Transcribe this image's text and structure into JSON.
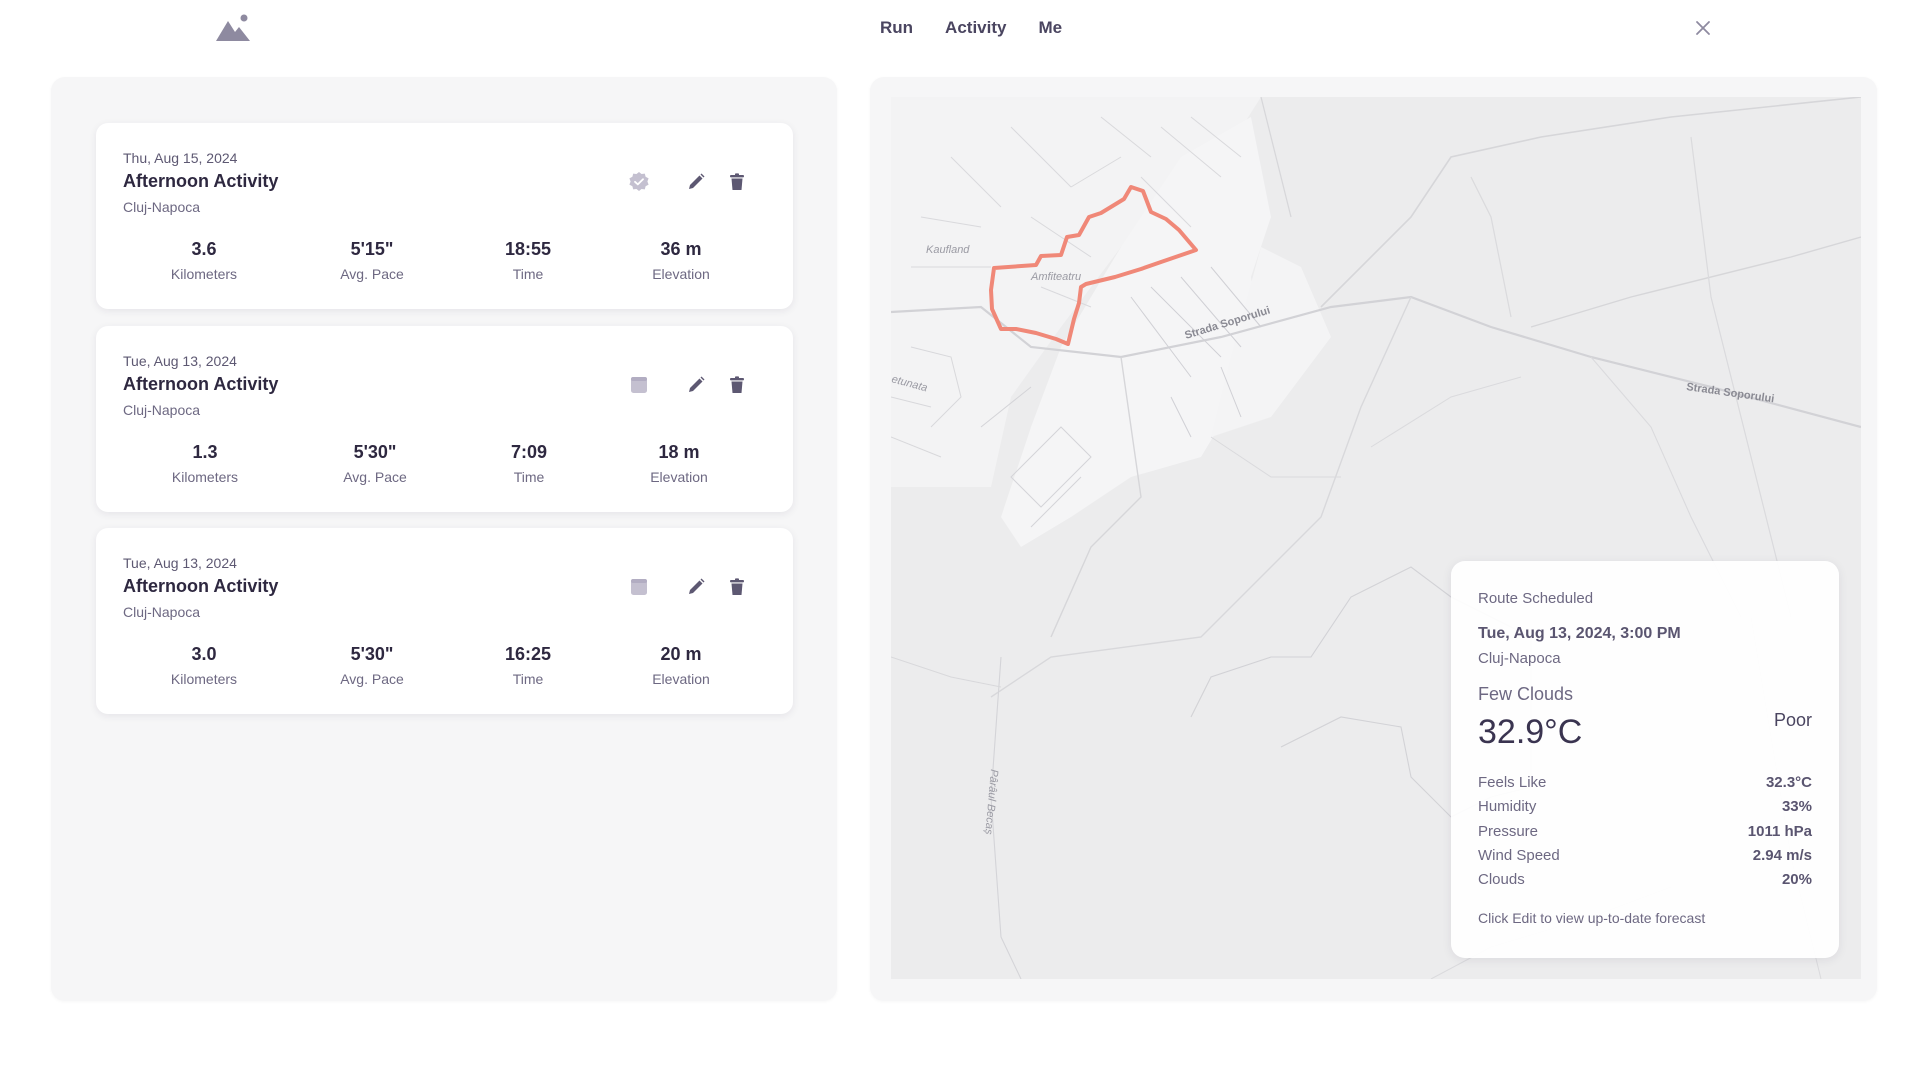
{
  "nav": {
    "items": [
      "Run",
      "Activity",
      "Me"
    ]
  },
  "colors": {
    "route": "#f08878",
    "accent": "#4a4560",
    "icon": "#5d5872",
    "icon_muted": "#c4c0d0"
  },
  "activities": [
    {
      "date": "Thu, Aug 15, 2024",
      "title": "Afternoon Activity",
      "location": "Cluj-Napoca",
      "status_icon": "verified-badge-icon",
      "stats": [
        {
          "value": "3.6",
          "label": "Kilometers"
        },
        {
          "value": "5'15\"",
          "label": "Avg. Pace"
        },
        {
          "value": "18:55",
          "label": "Time"
        },
        {
          "value": "36 m",
          "label": "Elevation"
        }
      ]
    },
    {
      "date": "Tue, Aug 13, 2024",
      "title": "Afternoon Activity",
      "location": "Cluj-Napoca",
      "status_icon": "calendar-icon",
      "stats": [
        {
          "value": "1.3",
          "label": "Kilometers"
        },
        {
          "value": "5'30\"",
          "label": "Avg. Pace"
        },
        {
          "value": "7:09",
          "label": "Time"
        },
        {
          "value": "18 m",
          "label": "Elevation"
        }
      ]
    },
    {
      "date": "Tue, Aug 13, 2024",
      "title": "Afternoon Activity",
      "location": "Cluj-Napoca",
      "status_icon": "calendar-icon",
      "stats": [
        {
          "value": "3.0",
          "label": "Kilometers"
        },
        {
          "value": "5'30\"",
          "label": "Avg. Pace"
        },
        {
          "value": "16:25",
          "label": "Time"
        },
        {
          "value": "20 m",
          "label": "Elevation"
        }
      ]
    }
  ],
  "map": {
    "labels": {
      "kaufland": "Kaufland",
      "amfiteatru": "Amfiteatru",
      "strada1": "Strada Soporului",
      "strada2": "Strada Soporului",
      "paraul": "Pârâul Becaș",
      "etunata": "etunata"
    }
  },
  "weather": {
    "status": "Route Scheduled",
    "datetime": "Tue, Aug 13, 2024, 3:00 PM",
    "location": "Cluj-Napoca",
    "condition": "Few Clouds",
    "temperature": "32.9°C",
    "rating": "Poor",
    "rows": [
      {
        "key": "Feels Like",
        "value": "32.3°C"
      },
      {
        "key": "Humidity",
        "value": "33%"
      },
      {
        "key": "Pressure",
        "value": "1011 hPa"
      },
      {
        "key": "Wind Speed",
        "value": "2.94 m/s"
      },
      {
        "key": "Clouds",
        "value": "20%"
      }
    ],
    "note": "Click Edit to view up-to-date forecast"
  }
}
